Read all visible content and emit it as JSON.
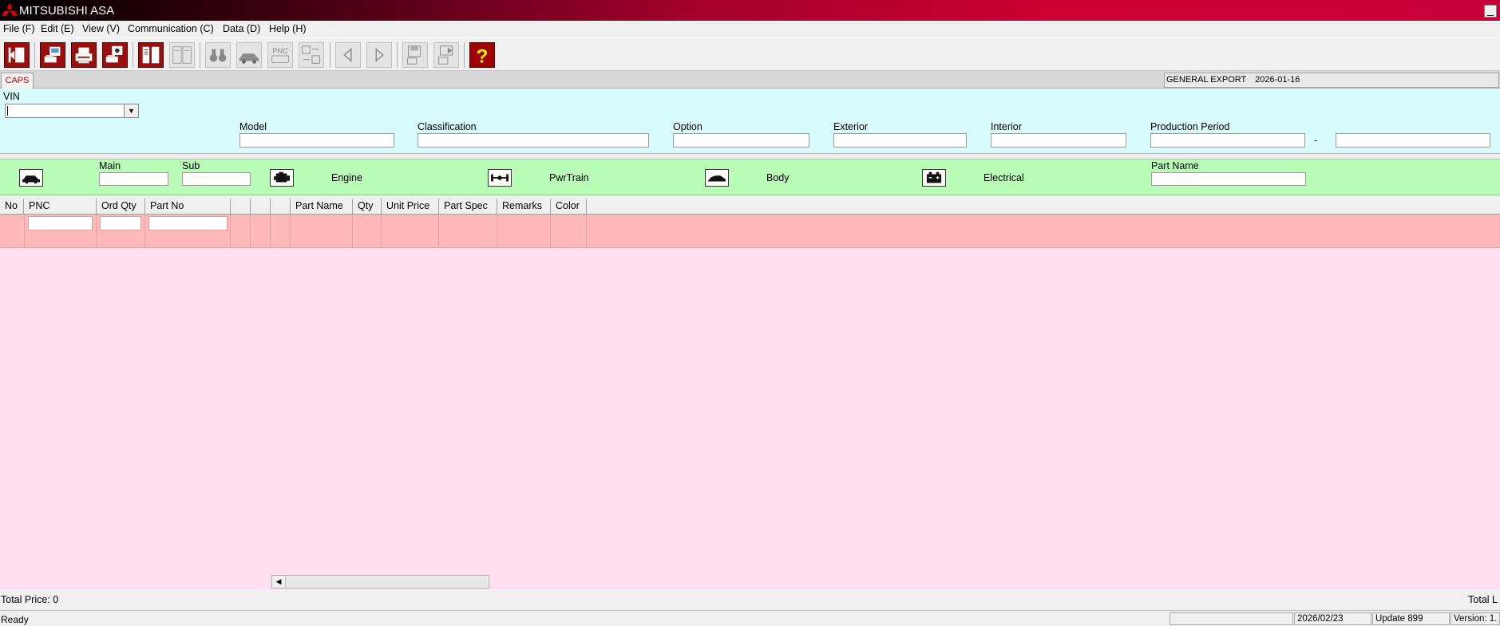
{
  "window": {
    "title": "MITSUBISHI ASA",
    "minimize_glyph": "_"
  },
  "menu": [
    "File (F)",
    "Edit (E)",
    "View (V)",
    "Communication (C)",
    "Data (D)",
    "Help (H)"
  ],
  "toolbar": {
    "icons": [
      "exit-icon",
      "print-preview-icon",
      "print-icon",
      "print-setup-icon",
      "single-page-icon",
      "double-page-icon",
      "binoculars-search-icon",
      "vehicle-icon",
      "pnc-icon",
      "parts-list-icon",
      "back-arrow-icon",
      "forward-arrow-icon",
      "save-disk-icon",
      "transfer-icon",
      "help-icon"
    ],
    "pnc_label": "PNC",
    "help_glyph": "?"
  },
  "tabs": {
    "active": "CAPS"
  },
  "info": {
    "region": "GENERAL EXPORT",
    "date": "2026-01-16"
  },
  "search": {
    "vin_label": "VIN",
    "vin_value": "",
    "model_label": "Model",
    "classification_label": "Classification",
    "option_label": "Option",
    "exterior_label": "Exterior",
    "interior_label": "Interior",
    "production_period_label": "Production Period",
    "period_separator": "-"
  },
  "categories": {
    "main_label": "Main",
    "sub_label": "Sub",
    "engine": "Engine",
    "pwrtrain": "PwrTrain",
    "body": "Body",
    "electrical": "Electrical",
    "part_name_label": "Part Name"
  },
  "table": {
    "headers": [
      "No",
      "PNC",
      "Ord Qty",
      "Part No",
      "",
      "",
      "",
      "Part Name",
      "Qty",
      "Unit Price",
      "Part Spec",
      "Remarks",
      "Color"
    ]
  },
  "totals": {
    "price": "Total Price: 0",
    "lines": "Total L"
  },
  "status": {
    "text": "Ready",
    "date": "2026/02/23",
    "update": "Update 899",
    "version": "Version: 1."
  },
  "colors": {
    "accent": "#9a0e0e",
    "search_bg": "#d8fcfc",
    "category_bg": "#b8fcb8",
    "row_bg": "#ffb8b8",
    "list_bg": "#ffe0f0"
  }
}
